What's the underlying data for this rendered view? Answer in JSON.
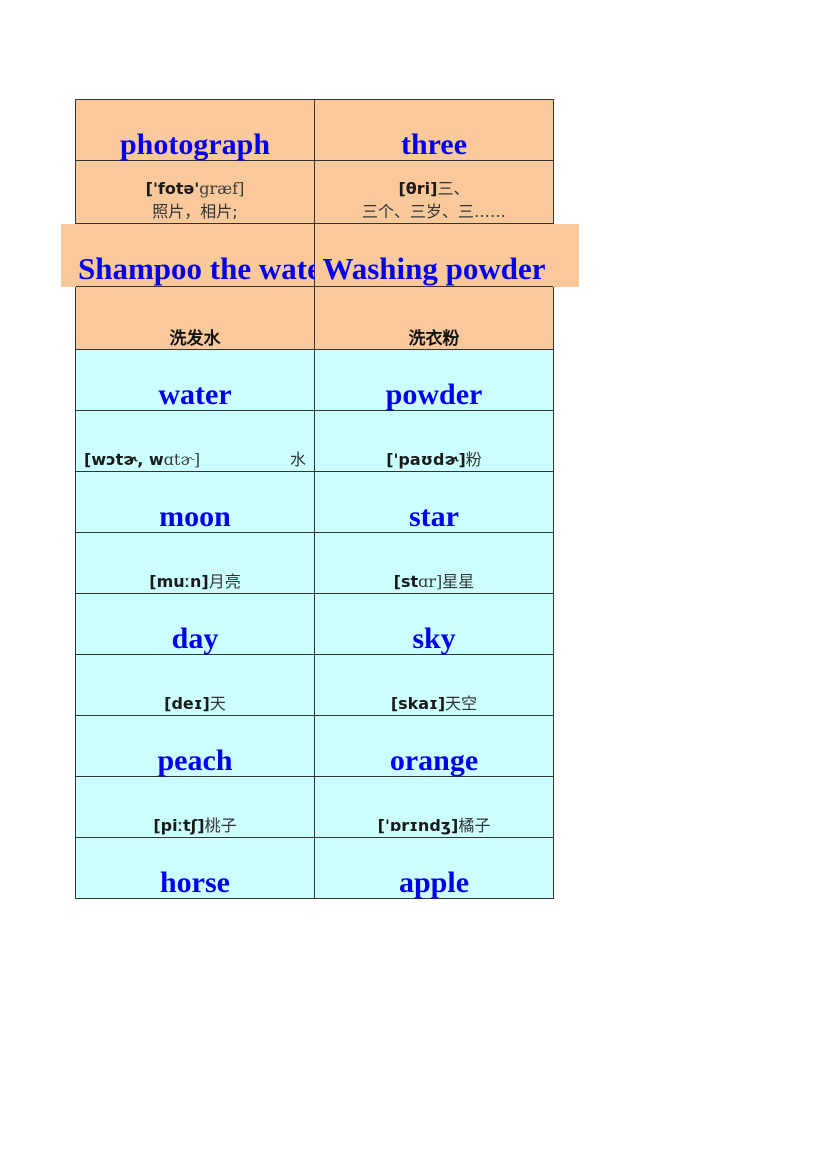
{
  "page": {
    "background": "#ffffff",
    "accent_word_color": "#0000ee",
    "fill_orange": "#fac99b",
    "fill_cyan": "#ccffff",
    "border_color": "#333333"
  },
  "table": {
    "columns": 2,
    "rows": [
      {
        "type": "word",
        "fill": "orange",
        "cells": [
          "photograph",
          "three"
        ]
      },
      {
        "type": "gloss-first",
        "fill": "orange",
        "cells": [
          {
            "ipa": "['fotə'",
            "ipa_light": "græf]",
            "cn": "照片，相片;"
          },
          {
            "ipa": "[θri]",
            "ipa_light": "",
            "cn": "三、",
            "cn2": "三个、三岁、三……"
          }
        ]
      },
      {
        "type": "overflow",
        "fill": "orange",
        "cells": [
          "Shampoo the water",
          "Washing powder"
        ],
        "visible_left": "ampoo the wa",
        "visible_right": "Washing powde"
      },
      {
        "type": "cn",
        "fill": "orange",
        "cells": [
          "洗发水",
          "洗衣粉"
        ]
      },
      {
        "type": "word",
        "fill": "cyan",
        "cells": [
          "water",
          "powder"
        ]
      },
      {
        "type": "gloss-spread",
        "fill": "cyan",
        "cells": [
          {
            "ipa": "[wɔtɚ, w",
            "ipa_light": "ɑtɚ]",
            "cn": "水"
          },
          {
            "ipa": "['paʊdɚ]",
            "ipa_light": "",
            "cn": "粉"
          }
        ]
      },
      {
        "type": "word",
        "fill": "cyan",
        "cells": [
          "moon",
          "star"
        ]
      },
      {
        "type": "gloss",
        "fill": "cyan",
        "cells": [
          {
            "ipa": "[muːn]",
            "ipa_light": "",
            "cn": "月亮"
          },
          {
            "ipa": "[st",
            "ipa_light": "ɑr]",
            "cn": "星星"
          }
        ]
      },
      {
        "type": "word",
        "fill": "cyan",
        "cells": [
          "day",
          "sky"
        ]
      },
      {
        "type": "gloss",
        "fill": "cyan",
        "cells": [
          {
            "ipa": "[deɪ]",
            "ipa_light": "",
            "cn": "天"
          },
          {
            "ipa": "[skaɪ]",
            "ipa_light": "",
            "cn": "天空"
          }
        ]
      },
      {
        "type": "word",
        "fill": "cyan",
        "cells": [
          "peach",
          "orange"
        ]
      },
      {
        "type": "gloss",
        "fill": "cyan",
        "cells": [
          {
            "ipa": "[piːtʃ]",
            "ipa_light": "",
            "cn": "桃子"
          },
          {
            "ipa": "['ɒrɪndʒ]",
            "ipa_light": "",
            "cn": "橘子"
          }
        ]
      },
      {
        "type": "word",
        "fill": "cyan",
        "cells": [
          "horse",
          "apple"
        ]
      }
    ]
  }
}
